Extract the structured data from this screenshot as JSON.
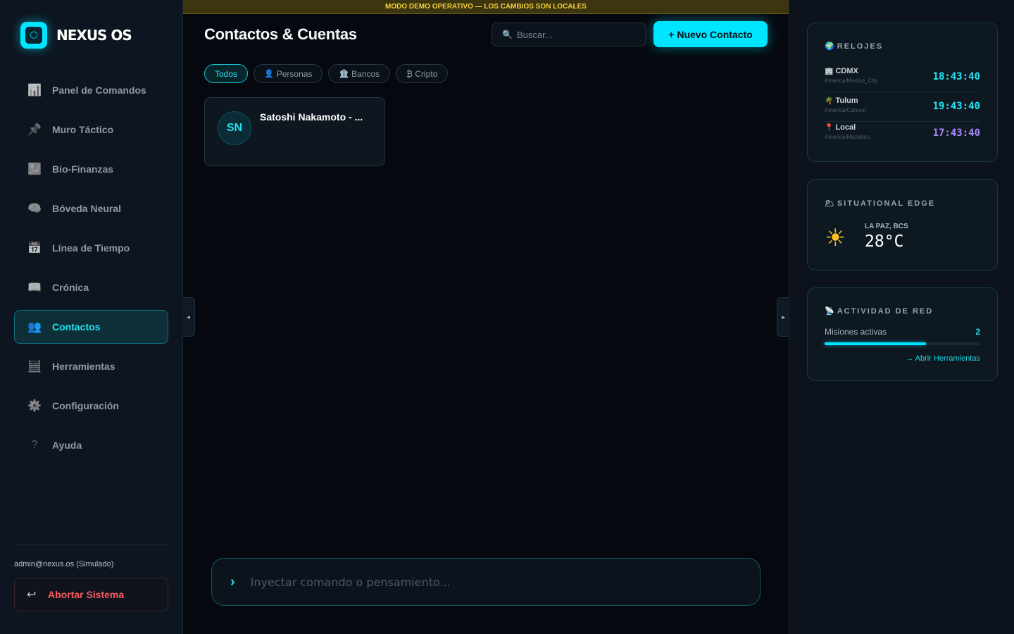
{
  "brand": {
    "name": "NEXUS OS",
    "logo_glyph": "⬡"
  },
  "sidebar": {
    "items": [
      {
        "icon": "📊",
        "icon_name": "chart-icon",
        "label": "Panel de Comandos",
        "active": false
      },
      {
        "icon": "📌",
        "icon_name": "pin-icon",
        "label": "Muro Táctico",
        "active": false
      },
      {
        "icon": "💹",
        "icon_name": "finance-chart-icon",
        "label": "Bio-Finanzas",
        "active": false
      },
      {
        "icon": "🧠",
        "icon_name": "brain-icon",
        "label": "Bóveda Neural",
        "active": false
      },
      {
        "icon": "📅",
        "icon_name": "calendar-icon",
        "label": "Línea de Tiempo",
        "active": false
      },
      {
        "icon": "📖",
        "icon_name": "book-icon",
        "label": "Crónica",
        "active": false
      },
      {
        "icon": "👥",
        "icon_name": "users-icon",
        "label": "Contactos",
        "active": true
      },
      {
        "icon": "🧮",
        "icon_name": "abacus-icon",
        "label": "Herramientas",
        "active": false
      },
      {
        "icon": "⚙️",
        "icon_name": "gear-icon",
        "label": "Configuración",
        "active": false
      },
      {
        "icon": "?",
        "icon_name": "help-icon",
        "label": "Ayuda",
        "active": false
      }
    ],
    "user": "admin@nexus.os (Simulado)",
    "abort": {
      "icon": "↩",
      "label": "Abortar Sistema"
    }
  },
  "banner": "MODO DEMO OPERATIVO — LOS CAMBIOS SON LOCALES",
  "main": {
    "title": "Contactos & Cuentas",
    "search": {
      "icon": "🔍",
      "placeholder": "Buscar..."
    },
    "new_button": "+ Nuevo Contacto",
    "filters": [
      {
        "icon": "",
        "icon_name": "",
        "label": "Todos",
        "active": true
      },
      {
        "icon": "👤",
        "icon_name": "person-icon",
        "label": "Personas",
        "active": false
      },
      {
        "icon": "🏦",
        "icon_name": "bank-icon",
        "label": "Bancos",
        "active": false
      },
      {
        "icon": "",
        "icon_name": "",
        "label": "₿ Cripto",
        "active": false
      }
    ],
    "contacts": [
      {
        "initials": "SN",
        "name": "Satoshi Nakamoto - ..."
      }
    ],
    "command": {
      "prompt": "›",
      "placeholder": "Inyectar comando o pensamiento..."
    }
  },
  "panel_toggles": {
    "left": "◂",
    "right": "▸"
  },
  "right": {
    "clocks": {
      "icon": "🌍",
      "title": "RELOJES",
      "rows": [
        {
          "icon": "🏢",
          "city": "CDMX",
          "tz": "America/Mexico_City",
          "time": "18:43:40",
          "local": false
        },
        {
          "icon": "🌴",
          "city": "Tulum",
          "tz": "America/Cancun",
          "time": "19:43:40",
          "local": false
        },
        {
          "icon": "📍",
          "city": "Local",
          "tz": "America/Mazatlan",
          "time": "17:43:40",
          "local": true
        }
      ]
    },
    "weather": {
      "icon": "🌥",
      "title": "SITUATIONAL EDGE",
      "sun": "☀",
      "place": "LA PAZ, BCS",
      "temp": "28°C"
    },
    "network": {
      "icon": "📡",
      "title": "ACTIVIDAD DE RED",
      "missions_label": "Misiones activas",
      "missions_count": "2",
      "progress_fraction": 0.65,
      "link": "→ Abrir Herramientas"
    }
  },
  "colors": {
    "accent": "#00e5ff",
    "danger": "#ff5a5f",
    "warning_text": "#f5cf3a",
    "local_time": "#a889ff"
  }
}
